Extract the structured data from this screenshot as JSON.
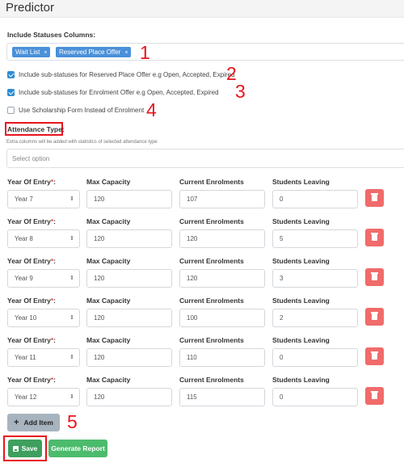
{
  "header": {
    "title": "Predictor"
  },
  "statuses": {
    "label": "Include Statuses Columns:",
    "tags": [
      {
        "label": "Wait List",
        "remove": "×"
      },
      {
        "label": "Reserved Place Offer",
        "remove": "×"
      }
    ]
  },
  "options": [
    {
      "label": "Include sub-statuses for Reserved Place Offer e.g Open, Accepted, Expired",
      "checked": true
    },
    {
      "label": "Include sub-statuses for Enrolment Offer e.g Open, Accepted, Expired",
      "checked": true
    },
    {
      "label": "Use Scholarship Form Instead of Enrolment",
      "checked": false
    }
  ],
  "attendance": {
    "label": "Attendance Type:",
    "hint": "Extra columns will be added with statistics of selected attendance type",
    "placeholder": "Select option"
  },
  "columns": {
    "year": "Year Of Entry",
    "required_mark": "*",
    "year_suffix": ":",
    "max": "Max Capacity",
    "current": "Current Enrolments",
    "leaving": "Students Leaving"
  },
  "rows": [
    {
      "year": "Year 7",
      "max": "120",
      "current": "107",
      "leaving": "0"
    },
    {
      "year": "Year 8",
      "max": "120",
      "current": "120",
      "leaving": "5"
    },
    {
      "year": "Year 9",
      "max": "120",
      "current": "120",
      "leaving": "3"
    },
    {
      "year": "Year 10",
      "max": "120",
      "current": "100",
      "leaving": "2"
    },
    {
      "year": "Year 11",
      "max": "120",
      "current": "110",
      "leaving": "0"
    },
    {
      "year": "Year 12",
      "max": "120",
      "current": "115",
      "leaving": "0"
    }
  ],
  "buttons": {
    "add_item": "Add Item",
    "add_icon": "+",
    "save": "Save",
    "generate_report": "Generate Report"
  },
  "annotations": [
    "1",
    "2",
    "3",
    "4",
    "5"
  ],
  "icons": {
    "select_arrow": "⇕"
  },
  "colors": {
    "tag": "#4a90d9",
    "checkbox": "#2d8cd1",
    "delete": "#f16b6b",
    "save": "#3e9f5e",
    "generate": "#4cbb6c",
    "annotation": "#e8141e"
  }
}
